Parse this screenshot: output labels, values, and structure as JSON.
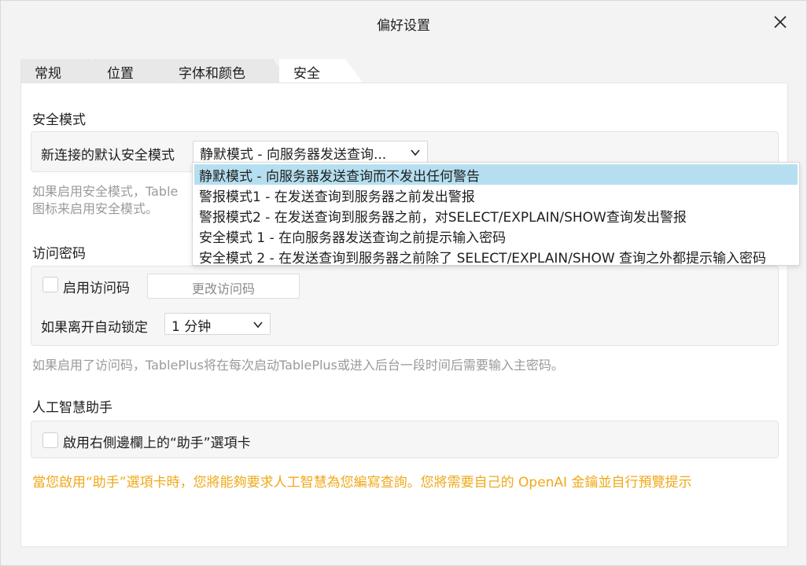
{
  "window": {
    "title": "偏好设置"
  },
  "tabs": [
    {
      "label": "常规"
    },
    {
      "label": "位置"
    },
    {
      "label": "字体和颜色"
    },
    {
      "label": "安全"
    }
  ],
  "safe_mode": {
    "section_title": "安全模式",
    "row_label": "新连接的默认安全模式",
    "select_value": "静默模式 - 向服务器发送查询...",
    "help_line1": "如果启用安全模式，Table",
    "help_line2": "图标来启用安全模式。",
    "options": [
      "静默模式 - 向服务器发送查询而不发出任何警告",
      "警报模式1 - 在发送查询到服务器之前发出警报",
      "警报模式2 - 在发送查询到服务器之前，对SELECT/EXPLAIN/SHOW查询发出警报",
      "安全模式 1 - 在向服务器发送查询之前提示输入密码",
      "安全模式 2 - 在发送查询到服务器之前除了 SELECT/EXPLAIN/SHOW 查询之外都提示输入密码"
    ],
    "selected_index": 0
  },
  "passcode": {
    "section_title": "访问密码",
    "enable_label": "启用访问码",
    "enable_checked": false,
    "change_button": "更改访问码",
    "autolock_label": "如果离开自动锁定",
    "autolock_value": "1 分钟",
    "help": "如果启用了访问码，TablePlus将在每次启动TablePlus或进入后台一段时间后需要输入主密码。"
  },
  "ai": {
    "section_title": "人工智慧助手",
    "enable_label": "啟用右側邊欄上的“助手”選項卡",
    "enable_checked": false,
    "warning": "當您啟用“助手”選項卡時，您將能夠要求人工智慧為您編寫查詢。您將需要自己的 OpenAI 金鑰並自行預覽提示"
  },
  "colors": {
    "dropdown_highlight": "#b5dff0",
    "warning": "#f0a818"
  }
}
